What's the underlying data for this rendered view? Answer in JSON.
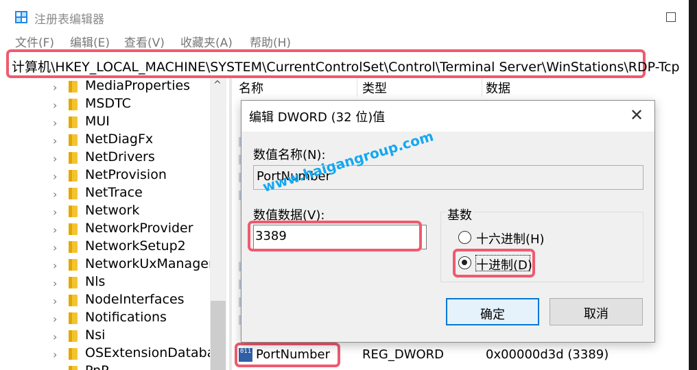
{
  "window": {
    "title": "注册表编辑器"
  },
  "menu": [
    "文件(F)",
    "编辑(E)",
    "查看(V)",
    "收藏夹(A)",
    "帮助(H)"
  ],
  "address": {
    "path": "计算机\\HKEY_LOCAL_MACHINE\\SYSTEM\\CurrentControlSet\\Control\\Terminal Server\\WinStations\\RDP-Tcp"
  },
  "tree": {
    "items": [
      "MediaProperties",
      "MSDTC",
      "MUI",
      "NetDiagFx",
      "NetDrivers",
      "NetProvision",
      "NetTrace",
      "Network",
      "NetworkProvider",
      "NetworkSetup2",
      "NetworkUxManager",
      "Nls",
      "NodeInterfaces",
      "Notifications",
      "Nsi",
      "OSExtensionDatabase",
      "PnP"
    ]
  },
  "list": {
    "columns": {
      "name": "名称",
      "type": "类型",
      "data": "数据"
    },
    "selected_row": {
      "name": "PortNumber",
      "type": "REG_DWORD",
      "data": "0x00000d3d (3389)",
      "icon_text": "011"
    }
  },
  "dialog": {
    "title": "编辑 DWORD (32 位)值",
    "value_name_label": "数值名称(N):",
    "value_name": "PortNumber",
    "value_data_label": "数值数据(V):",
    "value_data": "3389",
    "base_label": "基数",
    "hex_label": "十六进制(H)",
    "dec_label": "十进制(D)",
    "selected_base": "dec",
    "ok_label": "确定",
    "cancel_label": "取消"
  },
  "watermark": "www.haigangroup.com",
  "colors": {
    "highlight": "#f05a6e",
    "accent": "#0078d7",
    "watermark": "#13a8f0"
  }
}
